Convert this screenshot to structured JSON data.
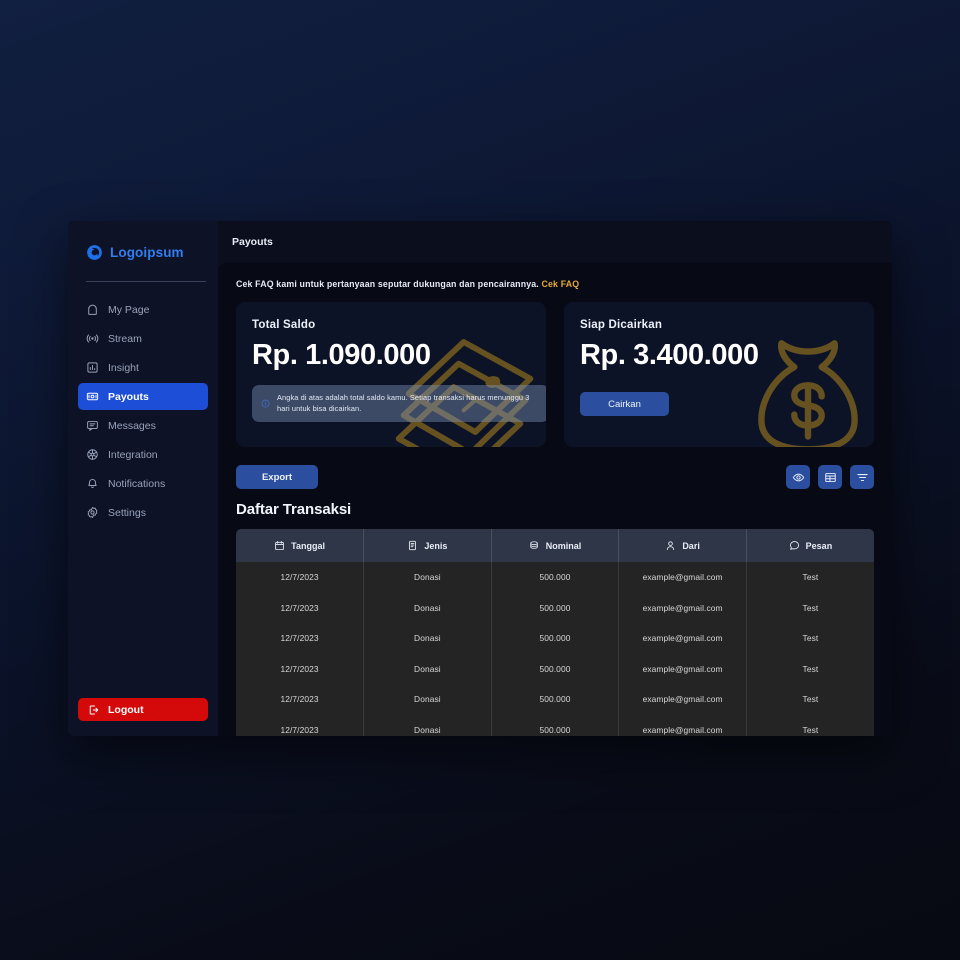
{
  "brand": {
    "name": "Logoipsum",
    "icon": "logo-mark-icon",
    "color": "#2f7ef0"
  },
  "sidebar": {
    "items": [
      {
        "label": "My Page",
        "icon": "home-icon",
        "active": false
      },
      {
        "label": "Stream",
        "icon": "broadcast-icon",
        "active": false
      },
      {
        "label": "Insight",
        "icon": "bar-chart-icon",
        "active": false
      },
      {
        "label": "Payouts",
        "icon": "money-icon",
        "active": true
      },
      {
        "label": "Messages",
        "icon": "chat-icon",
        "active": false
      },
      {
        "label": "Integration",
        "icon": "integration-icon",
        "active": false
      },
      {
        "label": "Notifications",
        "icon": "bell-icon",
        "active": false
      },
      {
        "label": "Settings",
        "icon": "gear-icon",
        "active": false
      }
    ],
    "logout": {
      "label": "Logout",
      "icon": "logout-icon",
      "color": "#d40a0a"
    }
  },
  "topbar": {
    "title": "Payouts"
  },
  "banner": {
    "text": "Cek FAQ kami untuk pertanyaan seputar dukungan dan pencairannya.",
    "link_label": "Cek FAQ",
    "link_color": "#e8a83a"
  },
  "cards": [
    {
      "title": "Total Saldo",
      "amount": "Rp. 1.090.000",
      "art": "banknotes-illustration",
      "info": {
        "icon": "info-icon",
        "text": "Angka di atas adalah total saldo kamu. Setiap transaksi harus menunggu 3 hari untuk bisa dicairkan."
      }
    },
    {
      "title": "Siap Dicairkan",
      "amount": "Rp. 3.400.000",
      "art": "money-bag-illustration",
      "button": {
        "label": "Cairkan",
        "color": "#2b4f9e"
      }
    }
  ],
  "actions": {
    "export_label": "Export",
    "icon_buttons": [
      {
        "name": "eye-icon",
        "title": "View"
      },
      {
        "name": "table-icon",
        "title": "Columns"
      },
      {
        "name": "filter-icon",
        "title": "Filter"
      }
    ]
  },
  "transactions": {
    "title": "Daftar Transaksi",
    "columns": [
      {
        "label": "Tanggal",
        "icon": "calendar-icon"
      },
      {
        "label": "Jenis",
        "icon": "document-icon"
      },
      {
        "label": "Nominal",
        "icon": "coins-icon"
      },
      {
        "label": "Dari",
        "icon": "person-icon"
      },
      {
        "label": "Pesan",
        "icon": "message-icon"
      }
    ],
    "rows": [
      {
        "tanggal": "12/7/2023",
        "jenis": "Donasi",
        "nominal": "500.000",
        "dari": "example@gmail.com",
        "pesan": "Test"
      },
      {
        "tanggal": "12/7/2023",
        "jenis": "Donasi",
        "nominal": "500.000",
        "dari": "example@gmail.com",
        "pesan": "Test"
      },
      {
        "tanggal": "12/7/2023",
        "jenis": "Donasi",
        "nominal": "500.000",
        "dari": "example@gmail.com",
        "pesan": "Test"
      },
      {
        "tanggal": "12/7/2023",
        "jenis": "Donasi",
        "nominal": "500.000",
        "dari": "example@gmail.com",
        "pesan": "Test"
      },
      {
        "tanggal": "12/7/2023",
        "jenis": "Donasi",
        "nominal": "500.000",
        "dari": "example@gmail.com",
        "pesan": "Test"
      },
      {
        "tanggal": "12/7/2023",
        "jenis": "Donasi",
        "nominal": "500.000",
        "dari": "example@gmail.com",
        "pesan": "Test"
      }
    ]
  }
}
